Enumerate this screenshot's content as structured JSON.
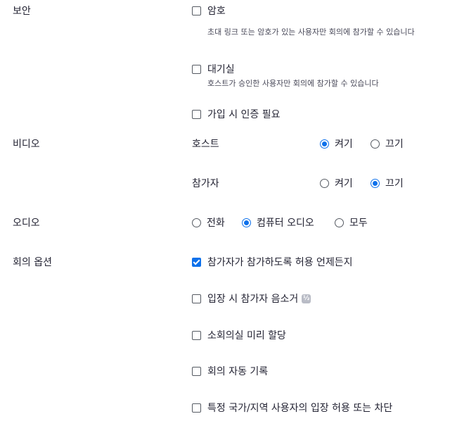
{
  "security": {
    "label": "보안",
    "passcode": {
      "label": "암호",
      "checked": false,
      "description": "초대 링크 또는 암호가 있는 사용자만 회의에 참가할 수 있습니다"
    },
    "waiting_room": {
      "label": "대기실",
      "checked": false,
      "description": "호스트가 승인한 사용자만 회의에 참가할 수 있습니다"
    },
    "auth_required": {
      "label": "가입 시 인증 필요",
      "checked": false
    }
  },
  "video": {
    "label": "비디오",
    "host": {
      "label": "호스트",
      "on_label": "켜기",
      "off_label": "끄기",
      "selected": "on"
    },
    "participant": {
      "label": "참가자",
      "on_label": "켜기",
      "off_label": "끄기",
      "selected": "off"
    }
  },
  "audio": {
    "label": "오디오",
    "options": [
      "전화",
      "컴퓨터 오디오",
      "모두"
    ],
    "selected": "컴퓨터 오디오"
  },
  "meeting_options": {
    "label": "회의 옵션",
    "items": [
      {
        "label": "참가자가 참가하도록 허용 언제든지",
        "checked": true
      },
      {
        "label": "입장 시 참가자 음소거",
        "checked": false,
        "badge": "½"
      },
      {
        "label": "소회의실 미리 할당",
        "checked": false
      },
      {
        "label": "회의 자동 기록",
        "checked": false
      },
      {
        "label": "특정 국가/지역 사용자의 입장 허용 또는 차단",
        "checked": false
      }
    ]
  },
  "colors": {
    "accent": "#0e71eb",
    "text": "#232333",
    "muted": "#4a4a5a"
  }
}
